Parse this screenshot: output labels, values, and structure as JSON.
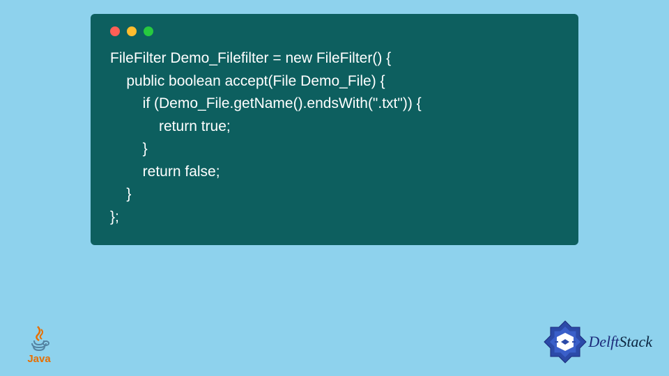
{
  "window": {
    "dots": [
      "red",
      "yellow",
      "green"
    ]
  },
  "code": {
    "lines": [
      "FileFilter Demo_Filefilter = new FileFilter() {",
      "    public boolean accept(File Demo_File) {",
      "        if (Demo_File.getName().endsWith(\".txt\")) {",
      "            return true;",
      "        }",
      "        return false;",
      "    }",
      "};"
    ]
  },
  "logos": {
    "java_label": "Java",
    "delft_text_1": "Delft",
    "delft_text_2": "Stack"
  },
  "colors": {
    "background": "#8ed2ed",
    "window_bg": "#0d5f5f",
    "dot_red": "#ff5f56",
    "dot_yellow": "#ffbd2e",
    "dot_green": "#27c93f",
    "java_orange": "#e76f00"
  }
}
